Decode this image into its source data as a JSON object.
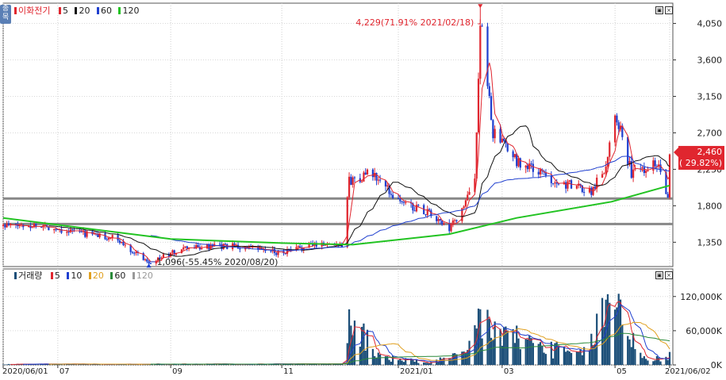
{
  "side_tab": "종목",
  "price_legend": {
    "name": "이화전기",
    "items": [
      {
        "label": "5",
        "color": "#e0262f"
      },
      {
        "label": "20",
        "color": "#111111"
      },
      {
        "label": "60",
        "color": "#1f3fcf"
      },
      {
        "label": "120",
        "color": "#22c322"
      }
    ]
  },
  "volume_legend": {
    "name": "거래량",
    "items": [
      {
        "label": "5",
        "color": "#e0262f"
      },
      {
        "label": "10",
        "color": "#1f3fcf"
      },
      {
        "label": "20",
        "color": "#e0a020"
      },
      {
        "label": "60",
        "color": "#2a8a3a"
      },
      {
        "label": "120",
        "color": "#999999"
      }
    ]
  },
  "colors": {
    "up": "#e0262f",
    "down": "#1f3fcf",
    "ma5": "#e0262f",
    "ma20": "#111111",
    "ma60": "#1f3fcf",
    "ma120": "#22c322",
    "volume": "#1b4e78",
    "support_line": "#888888"
  },
  "chart_data": [
    {
      "type": "candlestick",
      "title": "",
      "ylim": [
        1050,
        4300
      ],
      "y_ticks": [
        1350,
        1800,
        2250,
        2700,
        3150,
        3600,
        4050
      ],
      "y_tick_labels": [
        "1,350",
        "1,800",
        "2,250",
        "2,700",
        "3,150",
        "3,600",
        "4,050"
      ],
      "x_ticks": [
        {
          "date": "2020-06-01",
          "label": "2020/06/01"
        },
        {
          "date": "2020-07-01",
          "label": "07"
        },
        {
          "date": "2020-09-01",
          "label": "09"
        },
        {
          "date": "2020-11-01",
          "label": "11"
        },
        {
          "date": "2021-01-04",
          "label": "2021/01"
        },
        {
          "date": "2021-03-02",
          "label": "03"
        },
        {
          "date": "2021-05-03",
          "label": "05"
        },
        {
          "date": "2021-06-02",
          "label": "2021/06/02"
        }
      ],
      "date_range": [
        "2020-06-01",
        "2021-06-02"
      ],
      "horizontal_lines": [
        1890,
        1575
      ],
      "current_price": {
        "value": 2460,
        "label": "2,460",
        "change_label": "( 29.82%)"
      },
      "annotations": [
        {
          "date": "2021-02-18",
          "value": 4229,
          "text": "4,229(71.91% 2021/02/18)",
          "kind": "high"
        },
        {
          "date": "2020-08-20",
          "value": 1096,
          "text": "1,096(-55.45% 2020/08/20)",
          "kind": "low"
        }
      ],
      "anchors": [
        [
          "2020-06-01",
          1550
        ],
        [
          "2020-06-20",
          1560
        ],
        [
          "2020-07-10",
          1480
        ],
        [
          "2020-08-01",
          1400
        ],
        [
          "2020-08-20",
          1110
        ],
        [
          "2020-09-10",
          1280
        ],
        [
          "2020-10-05",
          1300
        ],
        [
          "2020-11-01",
          1220
        ],
        [
          "2020-11-20",
          1330
        ],
        [
          "2020-12-04",
          1330
        ],
        [
          "2020-12-08",
          2100
        ],
        [
          "2020-12-20",
          2200
        ],
        [
          "2021-01-05",
          1850
        ],
        [
          "2021-01-20",
          1720
        ],
        [
          "2021-02-01",
          1500
        ],
        [
          "2021-02-08",
          1750
        ],
        [
          "2021-02-15",
          2100
        ],
        [
          "2021-02-18",
          4100
        ],
        [
          "2021-02-25",
          2700
        ],
        [
          "2021-03-10",
          2350
        ],
        [
          "2021-04-01",
          2100
        ],
        [
          "2021-04-20",
          1980
        ],
        [
          "2021-04-28",
          2300
        ],
        [
          "2021-05-03",
          3000
        ],
        [
          "2021-05-12",
          2200
        ],
        [
          "2021-05-27",
          2350
        ],
        [
          "2021-06-01",
          1900
        ],
        [
          "2021-06-02",
          2460
        ]
      ],
      "ma120_anchors": [
        [
          "2020-06-01",
          1650
        ],
        [
          "2020-09-01",
          1390
        ],
        [
          "2020-11-01",
          1340
        ],
        [
          "2020-12-10",
          1320
        ],
        [
          "2021-02-01",
          1450
        ],
        [
          "2021-03-10",
          1650
        ],
        [
          "2021-05-01",
          1850
        ],
        [
          "2021-06-02",
          2050
        ]
      ]
    },
    {
      "type": "bar",
      "title": "",
      "ylim": [
        0,
        160000
      ],
      "y_ticks": [
        0,
        60000,
        120000
      ],
      "y_tick_labels": [
        "0K",
        "60,000K",
        "120,000K"
      ],
      "volume_anchors": [
        [
          "2020-06-01",
          1500
        ],
        [
          "2020-12-04",
          2000
        ],
        [
          "2020-12-08",
          80000
        ],
        [
          "2020-12-15",
          70000
        ],
        [
          "2020-12-25",
          15000
        ],
        [
          "2021-01-20",
          5000
        ],
        [
          "2021-02-10",
          20000
        ],
        [
          "2021-02-18",
          100000
        ],
        [
          "2021-02-26",
          70000
        ],
        [
          "2021-03-10",
          55000
        ],
        [
          "2021-04-01",
          30000
        ],
        [
          "2021-04-15",
          20000
        ],
        [
          "2021-05-03",
          145000
        ],
        [
          "2021-05-10",
          70000
        ],
        [
          "2021-05-20",
          10000
        ],
        [
          "2021-06-01",
          15000
        ],
        [
          "2021-06-02",
          40000
        ]
      ]
    }
  ]
}
